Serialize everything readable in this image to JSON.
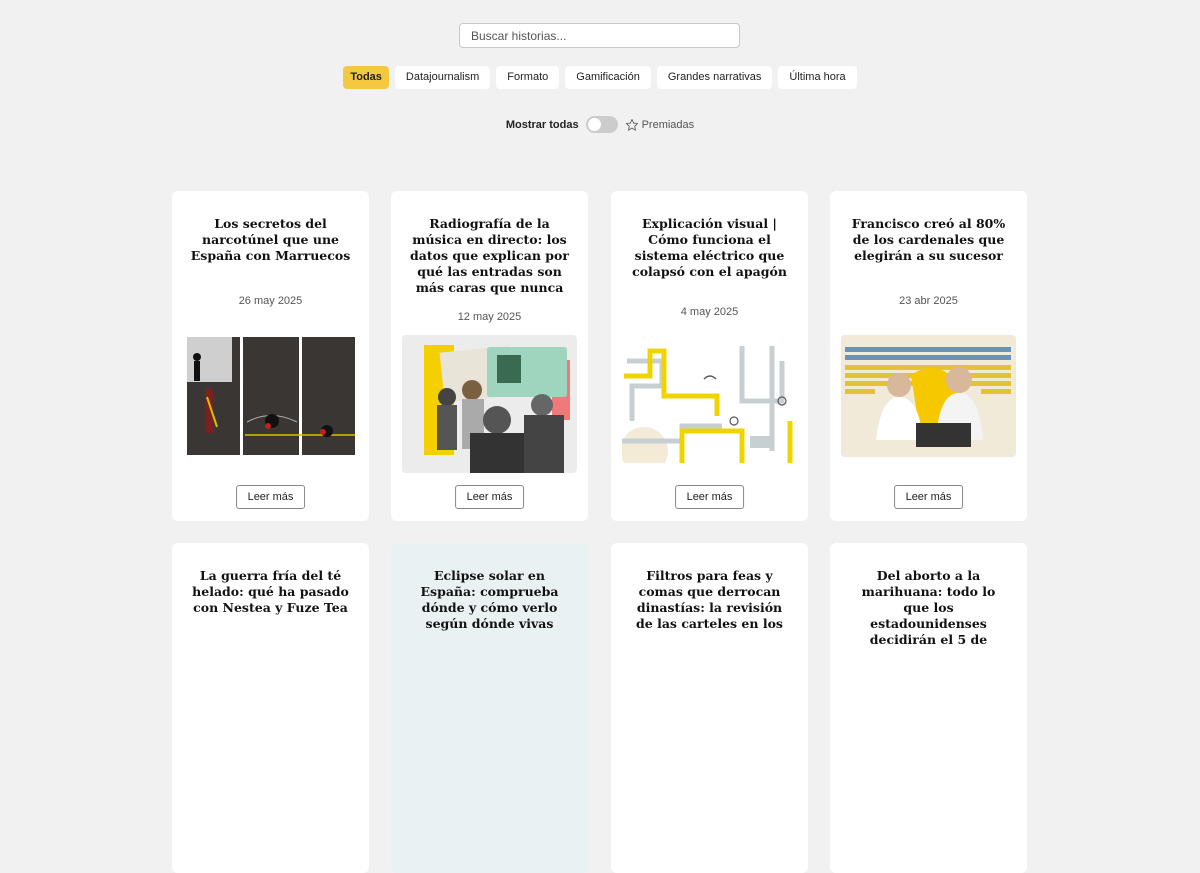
{
  "search": {
    "placeholder": "Buscar historias..."
  },
  "filters": {
    "all": "Todas",
    "datajournalism": "Datajournalism",
    "formato": "Formato",
    "gamificacion": "Gamificación",
    "grandes": "Grandes narrativas",
    "ultima": "Última hora"
  },
  "toggle": {
    "label": "Mostrar todas",
    "on": false,
    "premiadas": "Premiadas"
  },
  "read_more": "Leer más",
  "cards": [
    {
      "title": "Los secretos del narcotúnel que une España con Marruecos",
      "date": "26 may 2025"
    },
    {
      "title": "Radiografía de la música en directo: los datos que explican por qué las entradas son más caras que nunca",
      "date": "12 may 2025"
    },
    {
      "title": "Explicación visual | Cómo funciona el sistema eléctrico que colapsó con el apagón",
      "date": "4 may 2025"
    },
    {
      "title": "Francisco creó al 80% de los cardenales que elegirán a su sucesor",
      "date": "23 abr 2025"
    },
    {
      "title": "La guerra fría del té helado: qué ha pasado con Nestea y Fuze Tea",
      "date": ""
    },
    {
      "title": "Eclipse solar en España: comprueba dónde y cómo verlo según dónde vivas",
      "date": ""
    },
    {
      "title": "Filtros para feas y comas que derrocan dinastías: la revisión de las carteles en los",
      "date": ""
    },
    {
      "title": "Del aborto a la marihuana: todo lo que los estadounidenses decidirán el 5 de",
      "date": ""
    }
  ],
  "colors": {
    "accent": "#f5c842",
    "background": "#f1f1f1",
    "card": "#ffffff",
    "tinted_card": "#e9f1f3"
  }
}
